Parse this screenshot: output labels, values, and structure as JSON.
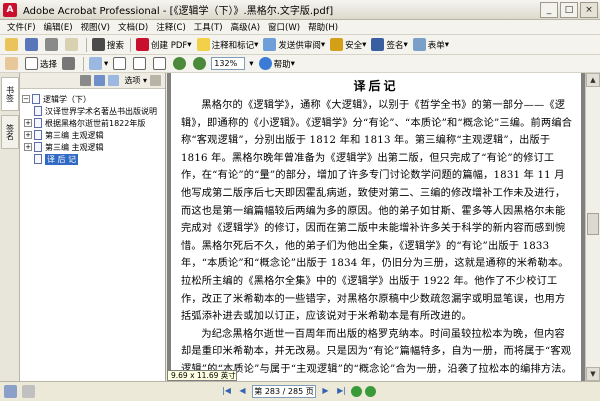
{
  "window": {
    "title": "Adobe Acrobat Professional - [《逻辑学（下）》.黑格尔.文字版.pdf]",
    "buttons": [
      "_",
      "□",
      "×"
    ]
  },
  "menu": [
    "文件(F)",
    "编辑(E)",
    "视图(V)",
    "文档(D)",
    "注释(C)",
    "工具(T)",
    "高级(A)",
    "窗口(W)",
    "帮助(H)"
  ],
  "toolbar1": {
    "search_label": "搜索",
    "create_pdf_label": "创建 PDF",
    "comment_label": "注释和标记",
    "send_review_label": "发送供审阅",
    "secure_label": "安全",
    "sign_label": "签名",
    "forms_label": "表单"
  },
  "toolbar2": {
    "select_label": "选择",
    "zoom_value": "132%",
    "help_label": "帮助"
  },
  "leftnav": {
    "tabs": [
      "书签",
      "签名"
    ]
  },
  "bookmark_panel": {
    "options_label": "选项"
  },
  "bookmarks": [
    {
      "label": "逻辑学（下）"
    },
    {
      "label": "汉译世界学术名著丛书出版说明"
    },
    {
      "label": "根据黑格尔逝世前1822年版"
    },
    {
      "label": "第三编 主观逻辑"
    },
    {
      "label": "第三编 主观逻辑"
    },
    {
      "label": "译 后 记"
    }
  ],
  "document": {
    "heading": "译后记",
    "paragraphs": [
      "黑格尔的《逻辑学》，通称《大逻辑》，以别于《哲学全书》的第一部分——《逻辑》，即通称的《小逻辑》。《逻辑学》分“有论”、“本质论”和“概念论”三编。前两编合称“客观逻辑”，分别出版于 1812 年和 1813 年。第三编称“主观逻辑”，出版于 1816 年。黑格尔晚年曾准备为《逻辑学》出第二版，但只完成了“有论”的修订工作，在“有论”的“量”的部分，增加了许多专门讨论数学问题的篇幅，1831 年 11 月他写成第二版序后七天即因霍乱病逝，致使对第二、三编的修改增补工作未及进行，而这也是第一编篇幅较后两编为多的原因。他的弟子如甘斯、霍多等人因黑格尔未能完成对《逻辑学》的修订，因而在第二版中未能增补许多关于科学的新内容而感到惋惜。黑格尔死后不久，他的弟子们为他出全集，《逻辑学》的“有论”出版于 1833 年，“本质论”和“概念论”出版于 1834 年，仍旧分为三册，这就是通称的米希勒本。拉松所主编的《黑格尔全集》中的《逻辑学》出版于 1922 年。他作了不少校订工作，改正了米希勒本的一些错字，对黑格尔原稿中少数疏忽漏字或明显笔误，也用方括弧添补进去或加以订正，应该说对于米希勒本是有所改进的。",
      "为纪念黑格尔逝世一百周年而出版的格罗克纳本。时间虽较拉松本为晚，但内容却是重印米希勒本，并无改易。只是因为“有论”篇幅特多，自为一册，而将属于“客观逻辑”的“本质论”与属于“主观逻辑”的“概念论”合为一册，沿袭了拉松本的编排方法。而与米希"
    ]
  },
  "page_size": "9.69 x 11.69 英寸",
  "status": {
    "page_indicator": "第 283 / 285 页"
  }
}
